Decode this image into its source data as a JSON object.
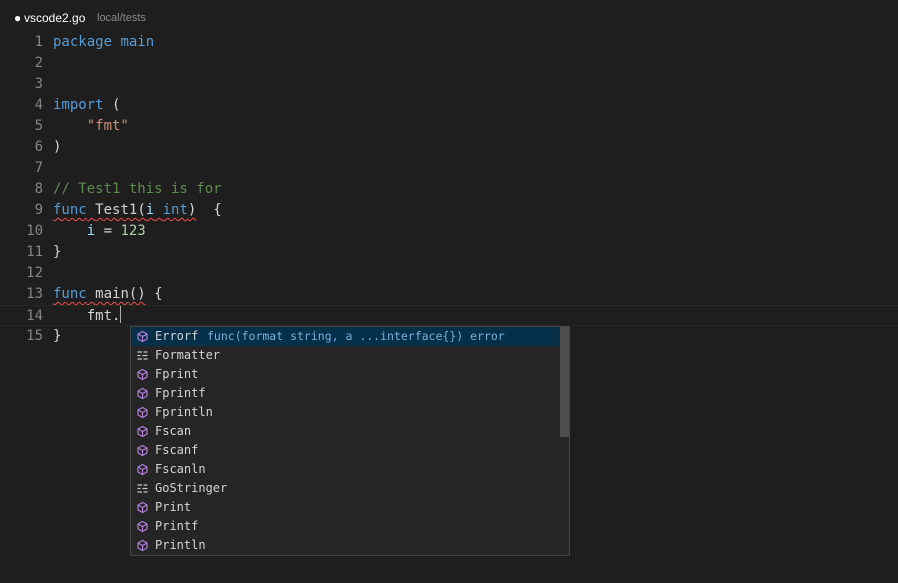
{
  "title": {
    "dirty_marker": "●",
    "file_name": "vscode2.go",
    "path": "local/tests"
  },
  "editor": {
    "lines": [
      {
        "number": "1",
        "tokens": [
          {
            "t": "package",
            "c": "kw"
          },
          {
            "t": " ",
            "c": "plain"
          },
          {
            "t": "main",
            "c": "kw"
          }
        ]
      },
      {
        "number": "2",
        "tokens": []
      },
      {
        "number": "3",
        "tokens": []
      },
      {
        "number": "4",
        "tokens": [
          {
            "t": "import",
            "c": "kw"
          },
          {
            "t": " (",
            "c": "plain"
          }
        ]
      },
      {
        "number": "5",
        "tokens": [
          {
            "t": "    ",
            "c": "plain"
          },
          {
            "t": "\"fmt\"",
            "c": "str"
          }
        ]
      },
      {
        "number": "6",
        "tokens": [
          {
            "t": ")",
            "c": "plain"
          }
        ]
      },
      {
        "number": "7",
        "tokens": []
      },
      {
        "number": "8",
        "tokens": [
          {
            "t": "// Test1 this is for",
            "c": "cmt"
          }
        ]
      },
      {
        "number": "9",
        "tokens": [
          {
            "t": "func",
            "c": "kw",
            "sq": true
          },
          {
            "t": " ",
            "c": "plain",
            "sq": true
          },
          {
            "t": "Test1",
            "c": "plain",
            "sq": true
          },
          {
            "t": "(",
            "c": "plain",
            "sq": true
          },
          {
            "t": "i",
            "c": "var",
            "sq": true
          },
          {
            "t": " ",
            "c": "plain",
            "sq": true
          },
          {
            "t": "int",
            "c": "kw",
            "sq": true
          },
          {
            "t": ")",
            "c": "plain",
            "sq": true
          },
          {
            "t": "  {",
            "c": "plain"
          }
        ]
      },
      {
        "number": "10",
        "tokens": [
          {
            "t": "    ",
            "c": "plain"
          },
          {
            "t": "i",
            "c": "var"
          },
          {
            "t": " = ",
            "c": "plain"
          },
          {
            "t": "123",
            "c": "num"
          }
        ]
      },
      {
        "number": "11",
        "tokens": [
          {
            "t": "}",
            "c": "plain"
          }
        ]
      },
      {
        "number": "12",
        "tokens": []
      },
      {
        "number": "13",
        "tokens": [
          {
            "t": "func",
            "c": "kw",
            "sq": true
          },
          {
            "t": " ",
            "c": "plain",
            "sq": true
          },
          {
            "t": "main",
            "c": "plain",
            "sq": true
          },
          {
            "t": "()",
            "c": "plain",
            "sq": true
          },
          {
            "t": " {",
            "c": "plain"
          }
        ]
      },
      {
        "number": "14",
        "tokens": [
          {
            "t": "    ",
            "c": "plain"
          },
          {
            "t": "fmt",
            "c": "plain"
          },
          {
            "t": ".",
            "c": "plain"
          }
        ],
        "current": true
      },
      {
        "number": "15",
        "tokens": [
          {
            "t": "}",
            "c": "plain"
          }
        ]
      }
    ]
  },
  "suggestions": {
    "items": [
      {
        "label": "Errorf",
        "detail": "func(format string, a ...interface{}) error",
        "kind": "function-icon",
        "selected": true
      },
      {
        "label": "Formatter",
        "kind": "interface-icon"
      },
      {
        "label": "Fprint",
        "kind": "function-icon"
      },
      {
        "label": "Fprintf",
        "kind": "function-icon"
      },
      {
        "label": "Fprintln",
        "kind": "function-icon"
      },
      {
        "label": "Fscan",
        "kind": "function-icon"
      },
      {
        "label": "Fscanf",
        "kind": "function-icon"
      },
      {
        "label": "Fscanln",
        "kind": "function-icon"
      },
      {
        "label": "GoStringer",
        "kind": "interface-icon"
      },
      {
        "label": "Print",
        "kind": "function-icon"
      },
      {
        "label": "Printf",
        "kind": "function-icon"
      },
      {
        "label": "Println",
        "kind": "function-icon"
      }
    ]
  },
  "colors": {
    "background": "#1e1e1e",
    "keyword": "#569cd6",
    "string": "#ce9178",
    "comment": "#608b4e",
    "number": "#b5cea8",
    "variable": "#9cdcfe",
    "selection": "#062f4a",
    "function_icon": "#b180d7",
    "error_squiggle": "#f14c4c"
  }
}
